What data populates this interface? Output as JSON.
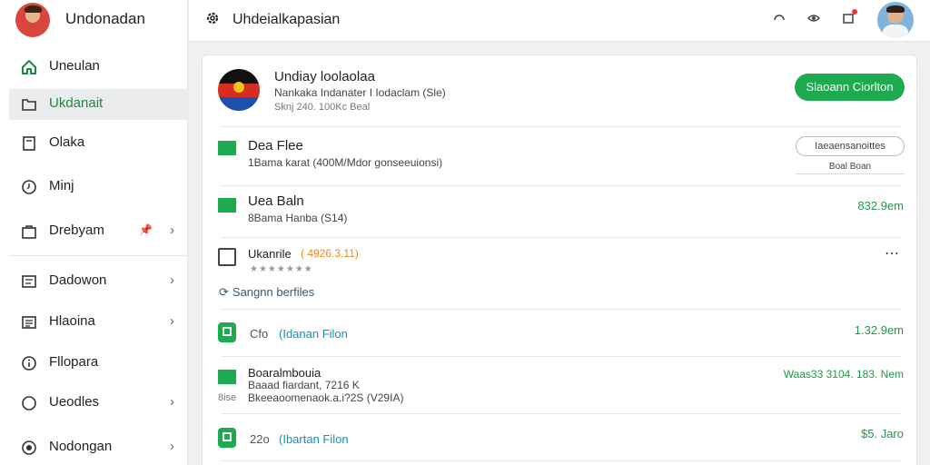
{
  "sidebar": {
    "profile_name": "Undonadan",
    "items": [
      {
        "label": "Uneulan",
        "icon": "home-icon"
      },
      {
        "label": "Ukdanait",
        "icon": "folder-icon"
      },
      {
        "label": "Olaka",
        "icon": "document-icon"
      },
      {
        "label": "Minj",
        "icon": "clock-icon"
      },
      {
        "label": "Drebyam",
        "icon": "briefcase-icon"
      },
      {
        "label": "Dadowon",
        "icon": "list-icon"
      },
      {
        "label": "Hlaoina",
        "icon": "list-icon"
      },
      {
        "label": "Fllopara",
        "icon": "info-icon"
      },
      {
        "label": "Ueodles",
        "icon": "circle-icon"
      },
      {
        "label": "Nodongan",
        "icon": "settings-icon"
      }
    ],
    "active_index": 1,
    "pin_icon": "pin-icon",
    "chevron": "›"
  },
  "topbar": {
    "title": "Uhdeialkapasian",
    "icons": [
      "gear-icon",
      "refresh-icon",
      "eye-icon",
      "notification-icon"
    ]
  },
  "card": {
    "header": {
      "title": "Undiay loolaolaa",
      "subtitle": "Nankaka Indanater I Iodaclam (Sle)",
      "meta": "Sknj 240. 100Kc Beal",
      "button": "Slaoann Ciorlton"
    },
    "rows": [
      {
        "title": "Dea Flee",
        "sub": "1Bama karat (400M/Mdor gonseeuionsi)",
        "button": "Iaeaensanoittes",
        "link": "Boal Boan"
      },
      {
        "title": "Uea Baln",
        "sub": "8Bama Hanba (S14)",
        "amount": "832.9em"
      },
      {
        "title": "Ukanrile",
        "tag": "( 4926.3.11)",
        "stars": "★★★★★★★",
        "menu": "⋯"
      },
      {
        "link": "Sangnn berfiles"
      },
      {
        "num": "Cfo",
        "title": "(Idanan Filon",
        "amount": "1.32.9em"
      },
      {
        "title": "Boaralmbouia",
        "sub": "Baaad fiardant, 7216 K",
        "sub2": "Bkeeaoomenaok.a.i?2S (V29IA)",
        "side": "8ise",
        "amount": "Waas33 3104. 183. Nem"
      },
      {
        "num": "22o",
        "title": "(Ibartan Filon",
        "amount": "$5. Jaro"
      }
    ]
  },
  "colors": {
    "accent": "#1eaa4e",
    "danger": "#e53935",
    "link": "#1a8fb4",
    "tag": "#f08a12"
  }
}
